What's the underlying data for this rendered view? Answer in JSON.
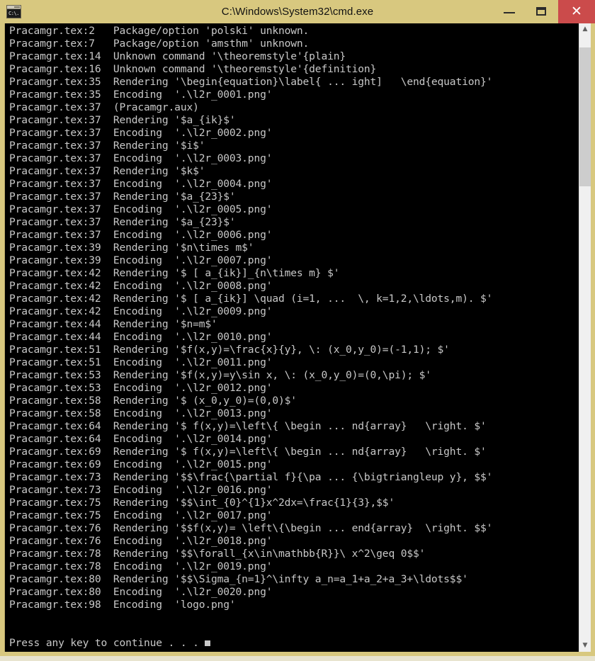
{
  "window": {
    "title": "C:\\Windows\\System32\\cmd.exe",
    "icon": "cmd-console-icon",
    "icon_text": "C:\\.",
    "titlebar_color": "#d8c87f",
    "close_button_color": "#cb4b4b",
    "console_bg": "#000000",
    "console_fg": "#c8c8c8"
  },
  "controls": {
    "minimize_label": "–",
    "maximize_label": "□",
    "close_label": "✕"
  },
  "scrollbar": {
    "up_arrow": "▲",
    "down_arrow": "▼",
    "thumb_position_percent": 2,
    "thumb_size_percent": 23
  },
  "console": {
    "lines": [
      "Pracamgr.tex:2   Package/option 'polski' unknown.",
      "Pracamgr.tex:7   Package/option 'amsthm' unknown.",
      "Pracamgr.tex:14  Unknown command '\\theoremstyle'{plain}",
      "Pracamgr.tex:16  Unknown command '\\theoremstyle'{definition}",
      "Pracamgr.tex:35  Rendering '\\begin{equation}\\label{ ... ight]   \\end{equation}'",
      "Pracamgr.tex:35  Encoding  '.\\l2r_0001.png'",
      "Pracamgr.tex:37  (Pracamgr.aux)",
      "Pracamgr.tex:37  Rendering '$a_{ik}$'",
      "Pracamgr.tex:37  Encoding  '.\\l2r_0002.png'",
      "Pracamgr.tex:37  Rendering '$i$'",
      "Pracamgr.tex:37  Encoding  '.\\l2r_0003.png'",
      "Pracamgr.tex:37  Rendering '$k$'",
      "Pracamgr.tex:37  Encoding  '.\\l2r_0004.png'",
      "Pracamgr.tex:37  Rendering '$a_{23}$'",
      "Pracamgr.tex:37  Encoding  '.\\l2r_0005.png'",
      "Pracamgr.tex:37  Rendering '$a_{23}$'",
      "Pracamgr.tex:37  Encoding  '.\\l2r_0006.png'",
      "Pracamgr.tex:39  Rendering '$n\\times m$'",
      "Pracamgr.tex:39  Encoding  '.\\l2r_0007.png'",
      "Pracamgr.tex:42  Rendering '$ [ a_{ik}]_{n\\times m} $'",
      "Pracamgr.tex:42  Encoding  '.\\l2r_0008.png'",
      "Pracamgr.tex:42  Rendering '$ [ a_{ik}] \\quad (i=1, ...  \\, k=1,2,\\ldots,m). $'",
      "Pracamgr.tex:42  Encoding  '.\\l2r_0009.png'",
      "Pracamgr.tex:44  Rendering '$n=m$'",
      "Pracamgr.tex:44  Encoding  '.\\l2r_0010.png'",
      "Pracamgr.tex:51  Rendering '$f(x,y)=\\frac{x}{y}, \\: (x_0,y_0)=(-1,1); $'",
      "Pracamgr.tex:51  Encoding  '.\\l2r_0011.png'",
      "Pracamgr.tex:53  Rendering '$f(x,y)=y\\sin x, \\: (x_0,y_0)=(0,\\pi); $'",
      "Pracamgr.tex:53  Encoding  '.\\l2r_0012.png'",
      "Pracamgr.tex:58  Rendering '$ (x_0,y_0)=(0,0)$'",
      "Pracamgr.tex:58  Encoding  '.\\l2r_0013.png'",
      "Pracamgr.tex:64  Rendering '$ f(x,y)=\\left\\{ \\begin ... nd{array}   \\right. $'",
      "Pracamgr.tex:64  Encoding  '.\\l2r_0014.png'",
      "Pracamgr.tex:69  Rendering '$ f(x,y)=\\left\\{ \\begin ... nd{array}   \\right. $'",
      "Pracamgr.tex:69  Encoding  '.\\l2r_0015.png'",
      "Pracamgr.tex:73  Rendering '$$\\frac{\\partial f}{\\pa ... {\\bigtriangleup y}, $$'",
      "Pracamgr.tex:73  Encoding  '.\\l2r_0016.png'",
      "Pracamgr.tex:75  Rendering '$$\\int_{0}^{1}x^2dx=\\frac{1}{3},$$'",
      "Pracamgr.tex:75  Encoding  '.\\l2r_0017.png'",
      "Pracamgr.tex:76  Rendering '$$f(x,y)= \\left\\{\\begin ... end{array}  \\right. $$'",
      "Pracamgr.tex:76  Encoding  '.\\l2r_0018.png'",
      "Pracamgr.tex:78  Rendering '$$\\forall_{x\\in\\mathbb{R}}\\ x^2\\geq 0$$'",
      "Pracamgr.tex:78  Encoding  '.\\l2r_0019.png'",
      "Pracamgr.tex:80  Rendering '$$\\Sigma_{n=1}^\\infty a_n=a_1+a_2+a_3+\\ldots$$'",
      "Pracamgr.tex:80  Encoding  '.\\l2r_0020.png'",
      "Pracamgr.tex:98  Encoding  'logo.png'",
      "",
      ""
    ],
    "prompt": "Press any key to continue . . . "
  }
}
